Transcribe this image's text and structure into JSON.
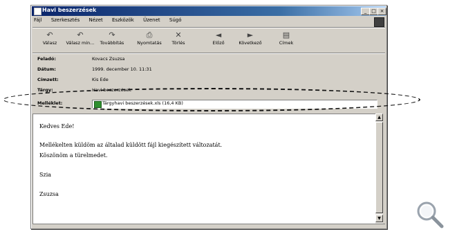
{
  "window": {
    "title": "Havi beszerzések"
  },
  "menu": [
    "Fájl",
    "Szerkesztés",
    "Nézet",
    "Eszközök",
    "Üzenet",
    "Súgó"
  ],
  "toolbar": [
    {
      "label": "Válasz",
      "icon": "reply-icon"
    },
    {
      "label": "Válasz min...",
      "icon": "reply-all-icon"
    },
    {
      "label": "Továbbítás",
      "icon": "forward-icon"
    },
    {
      "label": "Nyomtatás",
      "icon": "print-icon"
    },
    {
      "label": "Törlés",
      "icon": "delete-icon"
    },
    {
      "label": "Előző",
      "icon": "previous-icon"
    },
    {
      "label": "Következő",
      "icon": "next-icon"
    },
    {
      "label": "Címek",
      "icon": "address-book-icon"
    }
  ],
  "headers": {
    "from_label": "Feladó:",
    "from_value": "Kovacs Zsuzsa",
    "date_label": "Dátum:",
    "date_value": "1999. december 10. 11:31",
    "to_label": "Címzett:",
    "to_value": "Kis Ede",
    "subject_label": "Tárgy:",
    "subject_value": "Havi beszerzések",
    "attachment_label": "Melléklet:",
    "attachment_value": "Tárgyhavi beszerzések.xls (16,4 KB)"
  },
  "body": {
    "lines": [
      "Kedves Ede!",
      "Mellékelten küldöm az általad küldött fájl kiegészített változatát.",
      "Köszönöm a türelmedet.",
      "Szia",
      "Zsuzsa"
    ]
  },
  "colors": {
    "titlebar": "#0a246a",
    "face": "#d4d0c8"
  }
}
